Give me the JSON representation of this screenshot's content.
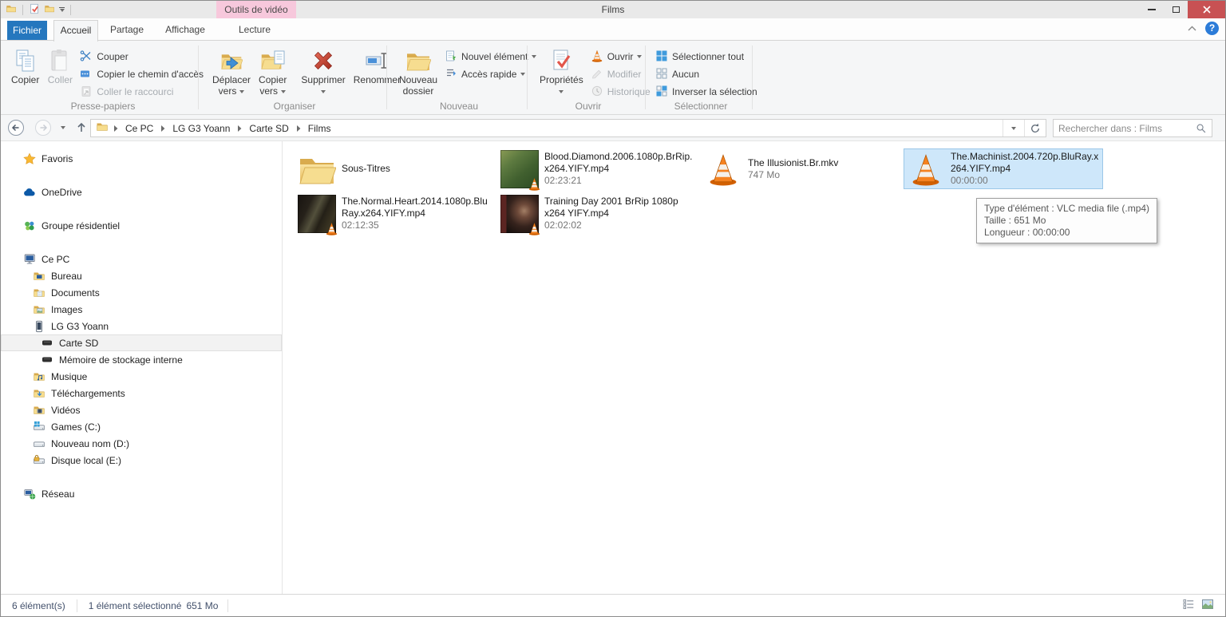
{
  "titlebar": {
    "title": "Films",
    "tool_tab": "Outils de vidéo"
  },
  "tabs": {
    "file": "Fichier",
    "home": "Accueil",
    "share": "Partage",
    "view": "Affichage",
    "play": "Lecture"
  },
  "ribbon": {
    "clipboard": {
      "group": "Presse-papiers",
      "copy": "Copier",
      "paste": "Coller",
      "cut": "Couper",
      "copy_path": "Copier le chemin d'accès",
      "paste_shortcut": "Coller le raccourci"
    },
    "organize": {
      "group": "Organiser",
      "move_l1": "Déplacer",
      "move_l2": "vers",
      "copyto_l1": "Copier",
      "copyto_l2": "vers",
      "delete": "Supprimer",
      "rename": "Renommer"
    },
    "new": {
      "group": "Nouveau",
      "folder_l1": "Nouveau",
      "folder_l2": "dossier",
      "new_item": "Nouvel élément",
      "quick_access": "Accès rapide"
    },
    "open": {
      "group": "Ouvrir",
      "properties": "Propriétés",
      "open": "Ouvrir",
      "edit": "Modifier",
      "history": "Historique"
    },
    "select": {
      "group": "Sélectionner",
      "select_all": "Sélectionner tout",
      "none": "Aucun",
      "invert": "Inverser la sélection"
    }
  },
  "address": {
    "crumbs": [
      "Ce PC",
      "LG G3 Yoann",
      "Carte SD",
      "Films"
    ],
    "search_placeholder": "Rechercher dans : Films"
  },
  "sidebar": {
    "items": [
      {
        "label": "Favoris"
      },
      {
        "label": "OneDrive"
      },
      {
        "label": "Groupe résidentiel"
      },
      {
        "label": "Ce PC"
      },
      {
        "label": "Bureau"
      },
      {
        "label": "Documents"
      },
      {
        "label": "Images"
      },
      {
        "label": "LG G3 Yoann"
      },
      {
        "label": "Carte SD"
      },
      {
        "label": "Mémoire de stockage interne"
      },
      {
        "label": "Musique"
      },
      {
        "label": "Téléchargements"
      },
      {
        "label": "Vidéos"
      },
      {
        "label": "Games (C:)"
      },
      {
        "label": "Nouveau nom (D:)"
      },
      {
        "label": "Disque local (E:)"
      },
      {
        "label": "Réseau"
      }
    ]
  },
  "files": [
    {
      "name": "Sous-Titres",
      "meta": ""
    },
    {
      "name": "Blood.Diamond.2006.1080p.BrRip.x264.YIFY.mp4",
      "meta": "02:23:21"
    },
    {
      "name": "The Illusionist.Br.mkv",
      "meta": "747 Mo"
    },
    {
      "name": "The.Machinist.2004.720p.BluRay.x264.YIFY.mp4",
      "meta": "00:00:00",
      "selected": true
    },
    {
      "name": "The.Normal.Heart.2014.1080p.BluRay.x264.YIFY.mp4",
      "meta": "02:12:35"
    },
    {
      "name": "Training Day 2001 BrRip 1080p x264 YIFY.mp4",
      "meta": "02:02:02"
    }
  ],
  "tooltip": {
    "lines": [
      "Type d'élément : VLC media file (.mp4)",
      "Taille : 651 Mo",
      "Longueur : 00:00:00"
    ]
  },
  "status": {
    "count": "6 élément(s)",
    "selection": "1 élément sélectionné",
    "size": "651 Mo"
  }
}
